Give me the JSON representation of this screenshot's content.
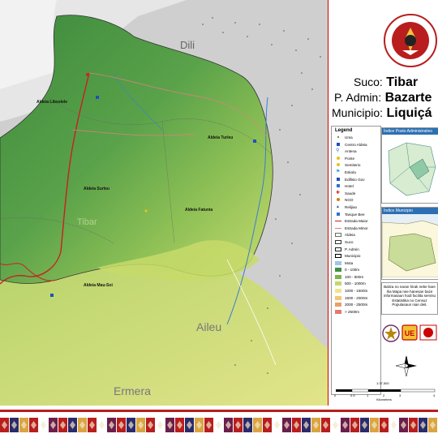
{
  "map": {
    "places": {
      "dili": "Dili",
      "aileu": "Aileu",
      "ermera": "Ermera"
    },
    "aldeias": {
      "liboslele": "Aldeia Liboslele",
      "turleu": "Aldeia Turleu",
      "surleu": "Aldeia Surleu",
      "fatunia": "Aldeia Fatunia",
      "mau_soi": "Aldeia Mau-Soi"
    },
    "suco_name": "Tibar"
  },
  "header": {
    "suco_label": "Suco:",
    "suco_value": "Tibar",
    "admin_label": "P. Admin:",
    "admin_value": "Bazarte",
    "municipio_label": "Municipio:",
    "municipio_value": "Liquiçá"
  },
  "legend": {
    "title": "Legend",
    "items": [
      {
        "label": "Uma",
        "icon": "dot",
        "color": "#555555"
      },
      {
        "label": "Centro Aldeia",
        "icon": "square",
        "color": "#1f4fbf"
      },
      {
        "label": "Antena",
        "icon": "antenna",
        "color": "#2e6fd8"
      },
      {
        "label": "Ponte",
        "icon": "circle",
        "color": "#e8c21a"
      },
      {
        "label": "Semiterio",
        "icon": "circle",
        "color": "#e8c21a"
      },
      {
        "label": "Eskola",
        "icon": "flag",
        "color": "#2aa0d8"
      },
      {
        "label": "Edifisio Gov",
        "icon": "square",
        "color": "#1f4fbf"
      },
      {
        "label": "Hotel",
        "icon": "square",
        "color": "#2e6fd8"
      },
      {
        "label": "Saude",
        "icon": "cross",
        "color": "#d62020"
      },
      {
        "label": "NGO",
        "icon": "circle",
        "color": "#d07f16"
      },
      {
        "label": "Relijiao",
        "icon": "church",
        "color": "#1f4fbf"
      },
      {
        "label": "Tanque Bee",
        "icon": "square",
        "color": "#2e6fd8"
      },
      {
        "label": "Estrada Maior",
        "icon": "line",
        "color": "#c82020"
      },
      {
        "label": "Estrada Minor",
        "icon": "line",
        "color": "#e08080"
      },
      {
        "label": "Aldeia",
        "icon": "box",
        "color": "#6b6b6b"
      },
      {
        "label": "Suco",
        "icon": "box",
        "color": "#333333"
      },
      {
        "label": "P. Admin",
        "icon": "box",
        "color": "#222222"
      },
      {
        "label": "Municipio",
        "icon": "box",
        "color": "#000000"
      },
      {
        "label": "Mota",
        "icon": "fill",
        "color": "#9fc5e8"
      },
      {
        "label": "0 - 100m",
        "icon": "fill",
        "color": "#3f8f3f"
      },
      {
        "label": "100 - 500m",
        "icon": "fill",
        "color": "#7fb548"
      },
      {
        "label": "500 - 1000m",
        "icon": "fill",
        "color": "#c3d86a"
      },
      {
        "label": "1000 - 1500m",
        "icon": "fill",
        "color": "#f0e58a"
      },
      {
        "label": "1500 - 2000m",
        "icon": "fill",
        "color": "#f2c777"
      },
      {
        "label": "2000 - 2500m",
        "icon": "fill",
        "color": "#ec9e6a"
      },
      {
        "label": "> 2500m",
        "icon": "fill",
        "color": "#e27a6a"
      }
    ]
  },
  "insets": {
    "posto_title": "Índice Posto Administrativo",
    "municipio_title": "Índice Municipio"
  },
  "note": "Baliza no naran hirak nebe hare iha Mapa nee hanesan baze informasaun hodi facilita servisu Estatistika no Censuz Populasaun nian deit.",
  "scale": {
    "ratio": "1:37,500",
    "ticks": [
      "0",
      "0.5",
      "1",
      "2",
      "3",
      "4"
    ],
    "unit": "Kilometers"
  },
  "compass": {
    "n": "N",
    "s": "S",
    "e": "E",
    "w": "W"
  },
  "emblem": {
    "text_top": "REPÚBLICA DEMOCRÁTICA DE TIMOR-LESTE",
    "text_bottom": "RDTL"
  }
}
